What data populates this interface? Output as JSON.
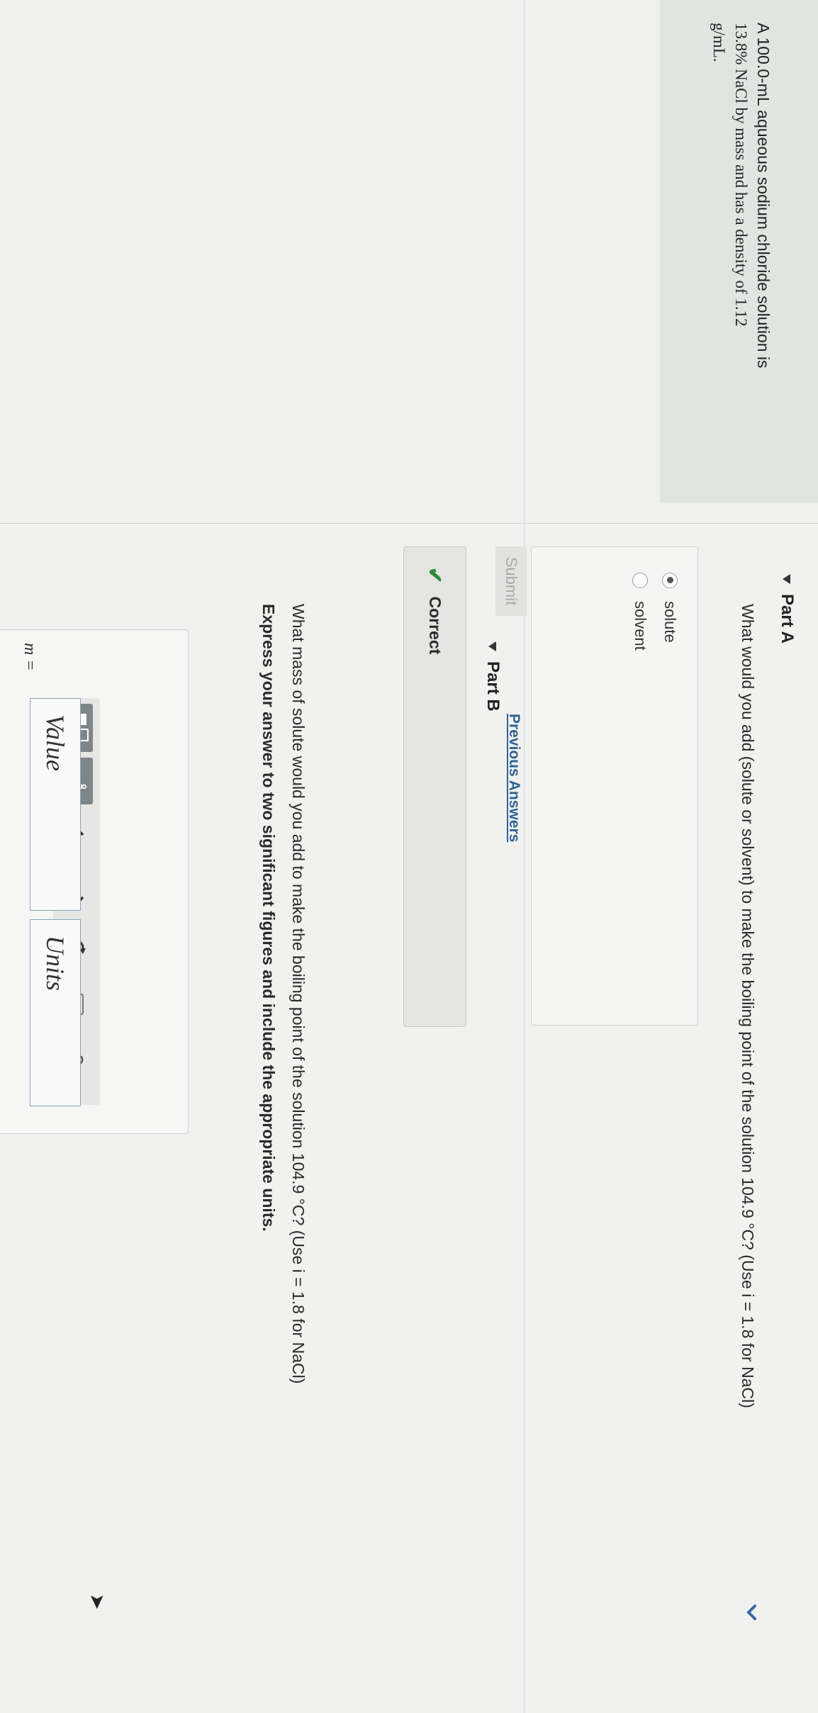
{
  "intro": {
    "line1": "A 100.0-mL aqueous sodium chloride solution is",
    "line2": "13.8% NaCl by mass and has a density of 1.12",
    "line3": "g/mL."
  },
  "partA": {
    "title": "Part A",
    "question": "What would you add (solute or solvent) to make the boiling point of the solution 104.9 °C? (Use i = 1.8 for NaCl)",
    "choices": [
      {
        "label": "solute",
        "selected": true
      },
      {
        "label": "solvent",
        "selected": false
      }
    ],
    "submit_label": "Submit",
    "previous_answers_label": "Previous Answers",
    "feedback": "Correct"
  },
  "partB": {
    "title": "Part B",
    "question": "What mass of solute would you add to make the boiling point of the solution 104.9 °C? (Use i = 1.8 for NaCl)",
    "instruction": "Express your answer to two significant figures and include the appropriate units.",
    "variable_label": "m =",
    "value_placeholder": "Value",
    "units_placeholder": "Units",
    "toolbar": {
      "templates_icon": "fraction-template-icon",
      "units_label": "μÅ",
      "undo_icon": "undo-icon",
      "redo_icon": "redo-icon",
      "reset_icon": "reset-icon",
      "keyboard_icon": "keyboard-icon",
      "help_label": "?"
    }
  },
  "colors": {
    "intro_bg": "#dfe6e1",
    "link": "#2f6394",
    "correct_check": "#2f8a3a",
    "field_border": "#8fa3b2"
  }
}
